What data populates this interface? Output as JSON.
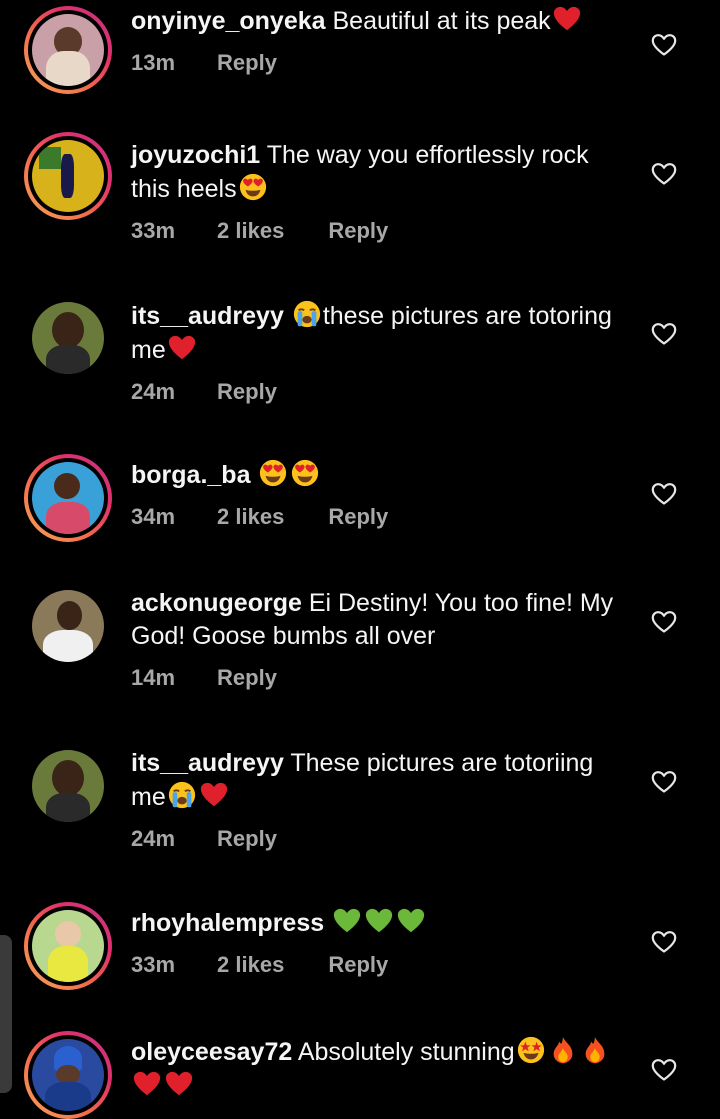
{
  "comments": [
    {
      "username": "onyinye_onyeka",
      "text": "Beautiful at its peak",
      "emojis_after": [
        "red-heart"
      ],
      "time": "13m",
      "likes": "",
      "reply": "Reply",
      "avatar": {
        "story": true,
        "bg": "#c9a0a8"
      }
    },
    {
      "username": "joyuzochi1",
      "text": "The way you effortlessly rock this heels",
      "emojis_after": [
        "heart-eyes"
      ],
      "time": "33m",
      "likes": "2 likes",
      "reply": "Reply",
      "avatar": {
        "story": true,
        "bg": "#d8b21a"
      }
    },
    {
      "username": "its__audreyy",
      "emojis_before": [
        "loudly-crying"
      ],
      "text": "these pictures are totoring me",
      "emojis_after": [
        "red-heart"
      ],
      "time": "24m",
      "likes": "",
      "reply": "Reply",
      "avatar": {
        "story": false,
        "bg": "#6a7a3a"
      }
    },
    {
      "username": "borga._ba",
      "text": "",
      "emojis_after": [
        "heart-eyes",
        "heart-eyes"
      ],
      "time": "34m",
      "likes": "2 likes",
      "reply": "Reply",
      "avatar": {
        "story": true,
        "bg": "#3aa0d8"
      }
    },
    {
      "username": "ackonugeorge",
      "text": "Ei Destiny! You too fine! My God! Goose bumbs all over",
      "emojis_after": [],
      "time": "14m",
      "likes": "",
      "reply": "Reply",
      "avatar": {
        "story": false,
        "bg": "#8a7a5a"
      }
    },
    {
      "username": "its__audreyy",
      "text": "These pictures are totoriing me",
      "emojis_after": [
        "loudly-crying",
        "red-heart"
      ],
      "time": "24m",
      "likes": "",
      "reply": "Reply",
      "avatar": {
        "story": false,
        "bg": "#6a7a3a"
      }
    },
    {
      "username": "rhoyhalempress",
      "text": "",
      "emojis_after": [
        "green-heart",
        "green-heart",
        "green-heart"
      ],
      "time": "33m",
      "likes": "2 likes",
      "reply": "Reply",
      "avatar": {
        "story": true,
        "bg": "#b8d890"
      }
    },
    {
      "username": "oleyceesay72",
      "text": "Absolutely stunning",
      "emojis_after": [
        "star-struck",
        "fire",
        "fire",
        "red-heart",
        "red-heart"
      ],
      "time": "",
      "likes": "",
      "reply": "",
      "avatar": {
        "story": true,
        "bg": "#2a4aa0"
      }
    }
  ],
  "icons": {
    "like": "heart-outline-icon"
  },
  "colors": {
    "background": "#000000",
    "text": "#f5f5f5",
    "meta": "#a8a8a8",
    "story_ring": [
      "#f9a65a",
      "#e1306c",
      "#c13584"
    ]
  }
}
